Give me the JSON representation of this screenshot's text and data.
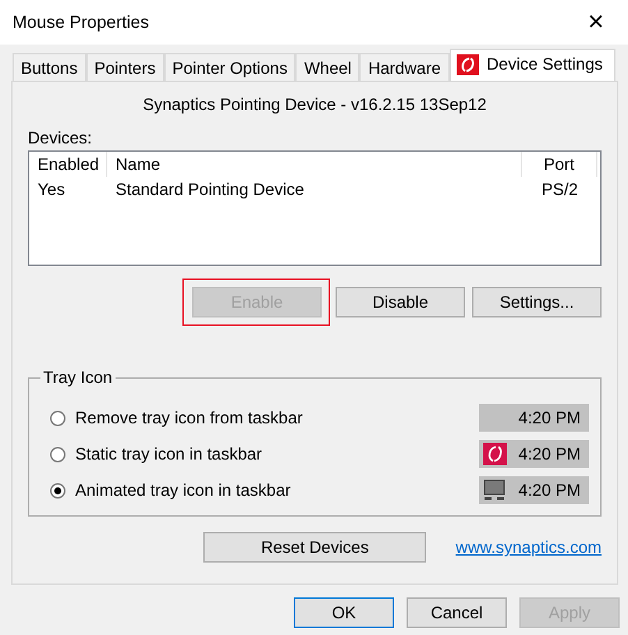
{
  "window": {
    "title": "Mouse Properties",
    "close": "×"
  },
  "tabs": [
    {
      "label": "Buttons",
      "selected": false
    },
    {
      "label": "Pointers",
      "selected": false
    },
    {
      "label": "Pointer Options",
      "selected": false
    },
    {
      "label": "Wheel",
      "selected": false
    },
    {
      "label": "Hardware",
      "selected": false
    },
    {
      "label": "Device Settings",
      "selected": true,
      "kind": "logo"
    }
  ],
  "heading": "Synaptics Pointing Device - v16.2.15 13Sep12",
  "devices": {
    "label": "Devices:",
    "columns": [
      "Enabled",
      "Name",
      "Port"
    ],
    "rows": [
      {
        "cells": [
          "Yes",
          "Standard Pointing Device",
          "PS/2"
        ]
      }
    ]
  },
  "device_buttons": [
    {
      "label": "Enable",
      "disabled": true,
      "highlighted": true
    },
    {
      "label": "Disable",
      "disabled": false,
      "highlighted": false
    },
    {
      "label": "Settings...",
      "disabled": false,
      "highlighted": false
    }
  ],
  "tray_icon": {
    "title": "Tray Icon",
    "options": [
      {
        "label": "Remove tray icon from taskbar",
        "selected": false,
        "kind": "none",
        "time": "4:20 PM"
      },
      {
        "label": "Static tray icon in taskbar",
        "selected": false,
        "kind": "static",
        "time": "4:20 PM"
      },
      {
        "label": "Animated tray icon in taskbar",
        "selected": true,
        "kind": "animated",
        "time": "4:20 PM"
      }
    ]
  },
  "reset_button": "Reset Devices",
  "link": "www.synaptics.com",
  "dialog_buttons": [
    {
      "label": "OK",
      "disabled": false,
      "default": true
    },
    {
      "label": "Cancel",
      "disabled": false,
      "default": false
    },
    {
      "label": "Apply",
      "disabled": true,
      "default": false
    }
  ]
}
